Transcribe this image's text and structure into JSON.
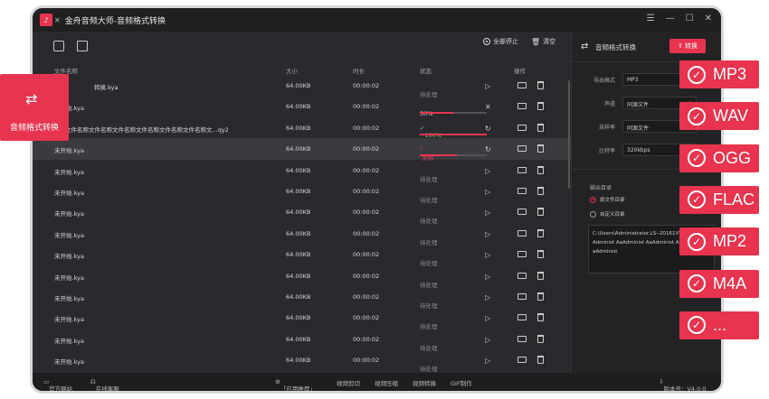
{
  "window": {
    "title": "金舟音频大师-音频格式转换"
  },
  "toolbar": {
    "all_stop": "全部停止",
    "clear": "清空"
  },
  "table": {
    "headers": {
      "name": "文件名称",
      "size": "大小",
      "duration": "时长",
      "status": "状态",
      "action": "操作"
    },
    "rows": [
      {
        "name": "转换.kya",
        "size": "64.00KB",
        "duration": "00:00:02",
        "status": "待处理",
        "kind": "pending",
        "cut": true
      },
      {
        "name": "未开始.kya",
        "size": "64.00KB",
        "duration": "00:00:02",
        "status": "50%",
        "kind": "progress",
        "progress": 0.5
      },
      {
        "name": "文件名称文件名称文件名称文件名称文件名称文件名称文...qy2",
        "size": "64.00KB",
        "duration": "00:00:02",
        "status": "100%",
        "kind": "done",
        "progress": 1.0
      },
      {
        "name": "未开始.kya",
        "size": "64.00KB",
        "duration": "00:00:02",
        "status": "失败",
        "kind": "fail",
        "progress": 0.55,
        "selected": true
      },
      {
        "name": "未开始.kya",
        "size": "64.00KB",
        "duration": "00:00:02",
        "status": "待处理",
        "kind": "pending"
      },
      {
        "name": "未开始.kya",
        "size": "64.00KB",
        "duration": "00:00:02",
        "status": "待处理",
        "kind": "pending"
      },
      {
        "name": "未开始.kya",
        "size": "64.00KB",
        "duration": "00:00:02",
        "status": "待处理",
        "kind": "pending"
      },
      {
        "name": "未开始.kya",
        "size": "64.00KB",
        "duration": "00:00:02",
        "status": "待处理",
        "kind": "pending"
      },
      {
        "name": "未开始.kya",
        "size": "64.00KB",
        "duration": "00:00:02",
        "status": "待处理",
        "kind": "pending"
      },
      {
        "name": "未开始.kya",
        "size": "64.00KB",
        "duration": "00:00:02",
        "status": "待处理",
        "kind": "pending"
      },
      {
        "name": "未开始.kya",
        "size": "64.00KB",
        "duration": "00:00:02",
        "status": "待处理",
        "kind": "pending"
      },
      {
        "name": "未开始.kya",
        "size": "64.00KB",
        "duration": "00:00:02",
        "status": "待处理",
        "kind": "pending"
      },
      {
        "name": "未开始.kya",
        "size": "64.00KB",
        "duration": "00:00:02",
        "status": "待处理",
        "kind": "pending"
      },
      {
        "name": "未开始.kya",
        "size": "64.00KB",
        "duration": "00:00:02",
        "status": "待处理",
        "kind": "pending"
      },
      {
        "name": "未开始.kya",
        "size": "64.00KB",
        "duration": "00:00:02",
        "status": "待处理",
        "kind": "pending"
      }
    ]
  },
  "panel": {
    "title": "音频格式转换",
    "convert": "转换",
    "fields": [
      {
        "label": "导出格式",
        "value": "MP3"
      },
      {
        "label": "声道",
        "value": "同源文件"
      },
      {
        "label": "采样率",
        "value": "同源文件"
      },
      {
        "label": "比特率",
        "value": "320kbps"
      }
    ],
    "output_label": "输出目录",
    "radio_source": "原文件目录",
    "radio_custom": "自定义目录",
    "path": "C:\\Users\\Administrator.LS--20161V\\Adminst AaAdminist AaAdminist AaAdminist AaAdminist AaAdminist"
  },
  "statusbar": {
    "website": "官方网站",
    "service": "在线客服",
    "recommend": "「应用推荐」",
    "video_cut": "视频剪切",
    "video_compress": "视频压缩",
    "video_convert": "视频转换",
    "gif": "GIF制作",
    "version": "版本号：V4.0.0"
  },
  "badge": {
    "label": "音频格式转换"
  },
  "formats": [
    "MP3",
    "WAV",
    "OGG",
    "FLAC",
    "MP2",
    "M4A",
    "..."
  ],
  "colors": {
    "accent": "#e8344e"
  }
}
